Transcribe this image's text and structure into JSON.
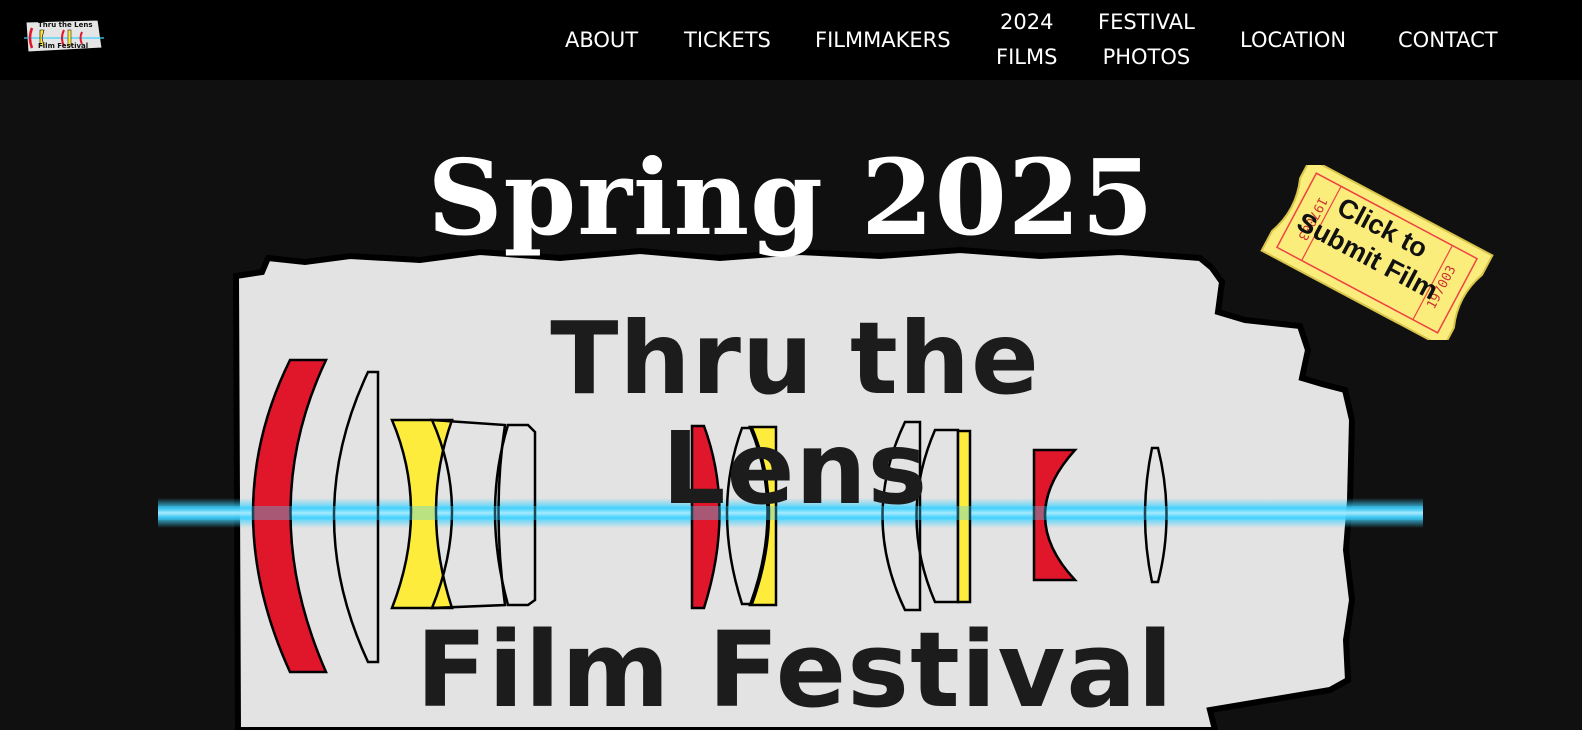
{
  "site": {
    "logo": {
      "line1": "Thru the Lens",
      "line2": "Film Festival",
      "icon": "film-lens-logo"
    }
  },
  "nav": {
    "items": [
      {
        "label": "ABOUT"
      },
      {
        "label": "TICKETS"
      },
      {
        "label": "FILMMAKERS"
      },
      {
        "line1": "2024",
        "line2": "FILMS"
      },
      {
        "line1": "FESTIVAL",
        "line2": "PHOTOS"
      },
      {
        "label": "LOCATION"
      },
      {
        "label": "CONTACT"
      }
    ]
  },
  "hero": {
    "season": "Spring 2025",
    "art": {
      "line1": "Thru the Lens",
      "line2": "Film Festival",
      "colors": {
        "red": "#e0162b",
        "yellow": "#fdec3c",
        "beam": "#3ed2ff",
        "card": "#e3e3e3"
      }
    },
    "ticket": {
      "label": "Click to Submit Film",
      "line1": "Click to",
      "line2": "Submit Film",
      "serial": "197003",
      "color": "#fbed7c"
    }
  }
}
